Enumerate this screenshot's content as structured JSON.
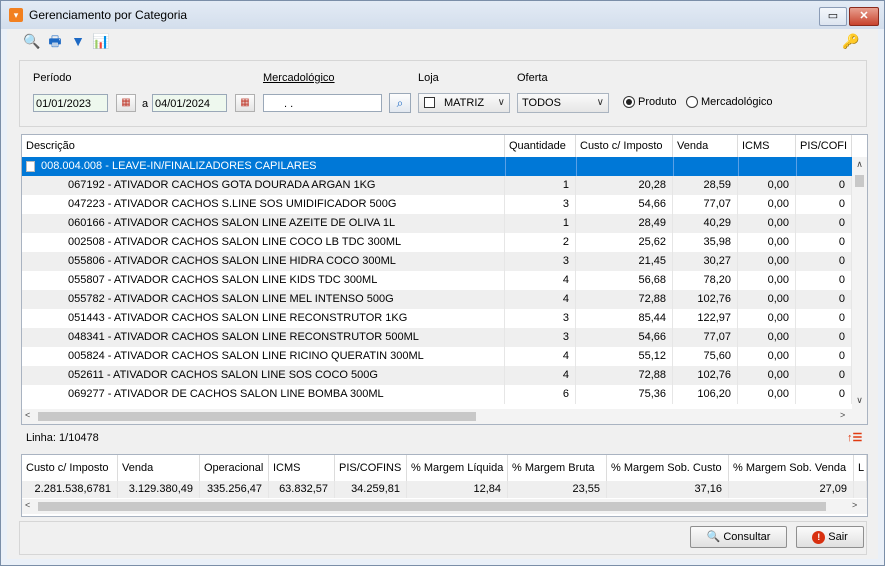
{
  "window": {
    "title": "Gerenciamento por Categoria",
    "restore_glyph": "▭",
    "close_glyph": "✕"
  },
  "toolbar": {
    "icons": [
      "search-doc-icon",
      "print-icon",
      "filter-icon",
      "chart-icon"
    ],
    "glyphs": [
      "🔍",
      "🖶",
      "▼",
      "📊"
    ],
    "key_glyph": "🔑"
  },
  "filters": {
    "periodo_label": "Período",
    "date_from": "01/01/2023",
    "separator": "a",
    "date_to": "04/01/2024",
    "mercadologico_label": "Mercadológico",
    "mercadologico_value": ". .",
    "loja_label": "Loja",
    "loja_value": "MATRIZ",
    "oferta_label": "Oferta",
    "oferta_value": "TODOS",
    "radio_produto": "Produto",
    "radio_mercadologico": "Mercadológico",
    "radio_selected": "Produto"
  },
  "grid": {
    "columns": [
      "Descrição",
      "Quantidade",
      "Custo c/ Imposto",
      "Venda",
      "ICMS",
      "PIS/COFI"
    ],
    "group_row": "008.004.008 - LEAVE-IN/FINALIZADORES CAPILARES",
    "rows": [
      [
        "067192 - ATIVADOR CACHOS GOTA DOURADA ARGAN 1KG",
        "1",
        "20,28",
        "28,59",
        "0,00",
        "0"
      ],
      [
        "047223 - ATIVADOR CACHOS S.LINE SOS UMIDIFICADOR 500G",
        "3",
        "54,66",
        "77,07",
        "0,00",
        "0"
      ],
      [
        "060166 - ATIVADOR CACHOS SALON LINE AZEITE DE OLIVA 1L",
        "1",
        "28,49",
        "40,29",
        "0,00",
        "0"
      ],
      [
        "002508 - ATIVADOR CACHOS SALON LINE COCO LB TDC 300ML",
        "2",
        "25,62",
        "35,98",
        "0,00",
        "0"
      ],
      [
        "055806 - ATIVADOR CACHOS SALON LINE HIDRA COCO 300ML",
        "3",
        "21,45",
        "30,27",
        "0,00",
        "0"
      ],
      [
        "055807 - ATIVADOR CACHOS SALON LINE KIDS TDC 300ML",
        "4",
        "56,68",
        "78,20",
        "0,00",
        "0"
      ],
      [
        "055782 - ATIVADOR CACHOS SALON LINE MEL INTENSO 500G",
        "4",
        "72,88",
        "102,76",
        "0,00",
        "0"
      ],
      [
        "051443 - ATIVADOR CACHOS SALON LINE RECONSTRUTOR 1KG",
        "3",
        "85,44",
        "122,97",
        "0,00",
        "0"
      ],
      [
        "048341 - ATIVADOR CACHOS SALON LINE RECONSTRUTOR 500ML",
        "3",
        "54,66",
        "77,07",
        "0,00",
        "0"
      ],
      [
        "005824 - ATIVADOR CACHOS SALON LINE RICINO QUERATIN 300ML",
        "4",
        "55,12",
        "75,60",
        "0,00",
        "0"
      ],
      [
        "052611 - ATIVADOR CACHOS SALON LINE SOS COCO 500G",
        "4",
        "72,88",
        "102,76",
        "0,00",
        "0"
      ],
      [
        "069277 - ATIVADOR DE CACHOS SALON LINE BOMBA 300ML",
        "6",
        "75,36",
        "106,20",
        "0,00",
        "0"
      ]
    ]
  },
  "status": {
    "linha": "Linha: 1/10478",
    "sort_glyph": "↑☰"
  },
  "totals": {
    "columns": [
      "Custo c/ Imposto",
      "Venda",
      "Operacional",
      "ICMS",
      "PIS/COFINS",
      "% Margem Líquida",
      "% Margem Bruta",
      "% Margem Sob. Custo",
      "% Margem Sob. Venda",
      "L"
    ],
    "values": [
      "2.281.538,6781",
      "3.129.380,49",
      "335.256,47",
      "63.832,57",
      "34.259,81",
      "12,84",
      "23,55",
      "37,16",
      "27,09",
      ""
    ]
  },
  "buttons": {
    "consultar": "Consultar",
    "sair": "Sair",
    "consultar_glyph": "🔍",
    "sair_glyph": "!"
  },
  "colors": {
    "selection": "#0078d7",
    "row_alt": "#efefef",
    "accent": "#f28020",
    "date_bg": "#eef8ee"
  }
}
